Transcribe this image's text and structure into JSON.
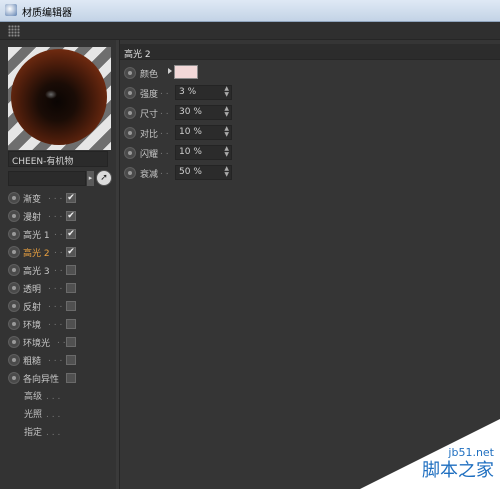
{
  "window": {
    "title": "材质编辑器"
  },
  "material": {
    "name": "CHEEN-有机物"
  },
  "channels": [
    {
      "label": "漸变",
      "dots": ". . .",
      "checked": "✔"
    },
    {
      "label": "漫射",
      "dots": ". . .",
      "checked": "✔"
    },
    {
      "label": "高光 1",
      "dots": ". .",
      "checked": "✔"
    },
    {
      "label": "高光 2",
      "dots": ". .",
      "checked": "✔"
    },
    {
      "label": "高光 3",
      "dots": ". .",
      "checked": ""
    },
    {
      "label": "透明",
      "dots": ". . .",
      "checked": ""
    },
    {
      "label": "反射",
      "dots": ". . .",
      "checked": ""
    },
    {
      "label": "环境",
      "dots": ". . .",
      "checked": ""
    },
    {
      "label": "环境光",
      "dots": ". .",
      "checked": ""
    },
    {
      "label": "粗糙",
      "dots": ". . .",
      "checked": ""
    },
    {
      "label": "各向异性",
      "dots": "",
      "checked": ""
    }
  ],
  "subitems": [
    {
      "label": "高级",
      "dots": ". . ."
    },
    {
      "label": "光照",
      "dots": ". . ."
    },
    {
      "label": "指定",
      "dots": ". . ."
    }
  ],
  "panel": {
    "heading": "高光 2",
    "color_label": "颜色",
    "color_value": "#f2d8d8",
    "props": [
      {
        "label": "强度",
        "dots": ". .",
        "value": "3 %"
      },
      {
        "label": "尺寸",
        "dots": ". .",
        "value": "30 %"
      },
      {
        "label": "对比",
        "dots": ". .",
        "value": "10 %"
      },
      {
        "label": "闪耀",
        "dots": ". .",
        "value": "10 %"
      },
      {
        "label": "衰减",
        "dots": ". .",
        "value": "50 %"
      }
    ]
  },
  "watermark": {
    "site": "jb51.net",
    "brand": "脚本之家"
  },
  "colors": {
    "active_channel": "#e8a040",
    "panel_bg": "#353535"
  }
}
